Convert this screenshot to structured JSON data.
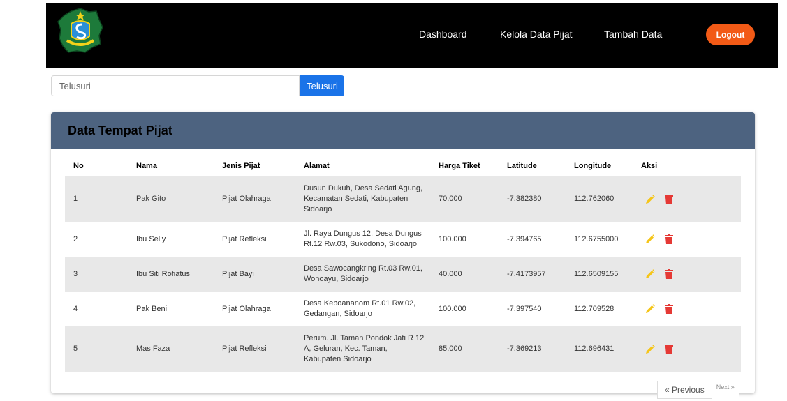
{
  "nav": {
    "links": [
      "Dashboard",
      "Kelola Data Pijat",
      "Tambah Data"
    ],
    "logout": "Logout"
  },
  "search": {
    "placeholder": "Telusuri",
    "button": "Telusuri"
  },
  "card": {
    "title": "Data Tempat Pijat"
  },
  "table": {
    "headers": [
      "No",
      "Nama",
      "Jenis Pijat",
      "Alamat",
      "Harga Tiket",
      "Latitude",
      "Longitude",
      "Aksi"
    ],
    "rows": [
      {
        "no": "1",
        "nama": "Pak Gito",
        "jenis": "Pijat Olahraga",
        "alamat": "Dusun Dukuh, Desa Sedati Agung, Kecamatan Sedati, Kabupaten Sidoarjo",
        "harga": "70.000",
        "lat": "-7.382380",
        "lon": "112.762060"
      },
      {
        "no": "2",
        "nama": "Ibu Selly",
        "jenis": "Pijat Refleksi",
        "alamat": "Jl. Raya Dungus 12, Desa Dungus Rt.12 Rw.03, Sukodono, Sidoarjo",
        "harga": "100.000",
        "lat": "-7.394765",
        "lon": "112.6755000"
      },
      {
        "no": "3",
        "nama": "Ibu Siti Rofiatus",
        "jenis": "Pijat Bayi",
        "alamat": "Desa Sawocangkring Rt.03 Rw.01, Wonoayu, Sidoarjo",
        "harga": "40.000",
        "lat": "-7.4173957",
        "lon": "112.6509155"
      },
      {
        "no": "4",
        "nama": "Pak Beni",
        "jenis": "Pijat Olahraga",
        "alamat": "Desa Keboananom Rt.01 Rw.02, Gedangan, Sidoarjo",
        "harga": "100.000",
        "lat": "-7.397540",
        "lon": "112.709528"
      },
      {
        "no": "5",
        "nama": "Mas Faza",
        "jenis": "Pijat Refleksi",
        "alamat": "Perum. Jl. Taman Pondok Jati R 12 A, Geluran, Kec. Taman, Kabupaten Sidoarjo",
        "harga": "85.000",
        "lat": "-7.369213",
        "lon": "112.696431"
      }
    ]
  },
  "pagination": {
    "previous": "« Previous",
    "next": "Next »"
  },
  "colors": {
    "navbar": "#000000",
    "logout": "#f25a16",
    "search_button": "#1a73e8",
    "card_header": "#4d6380",
    "row_stripe": "#e8e8e8",
    "edit_icon": "#f5c518",
    "delete_icon": "#e53935"
  },
  "icons": {
    "logo": "regency-emblem-logo",
    "edit": "pencil-icon",
    "delete": "trash-icon"
  }
}
